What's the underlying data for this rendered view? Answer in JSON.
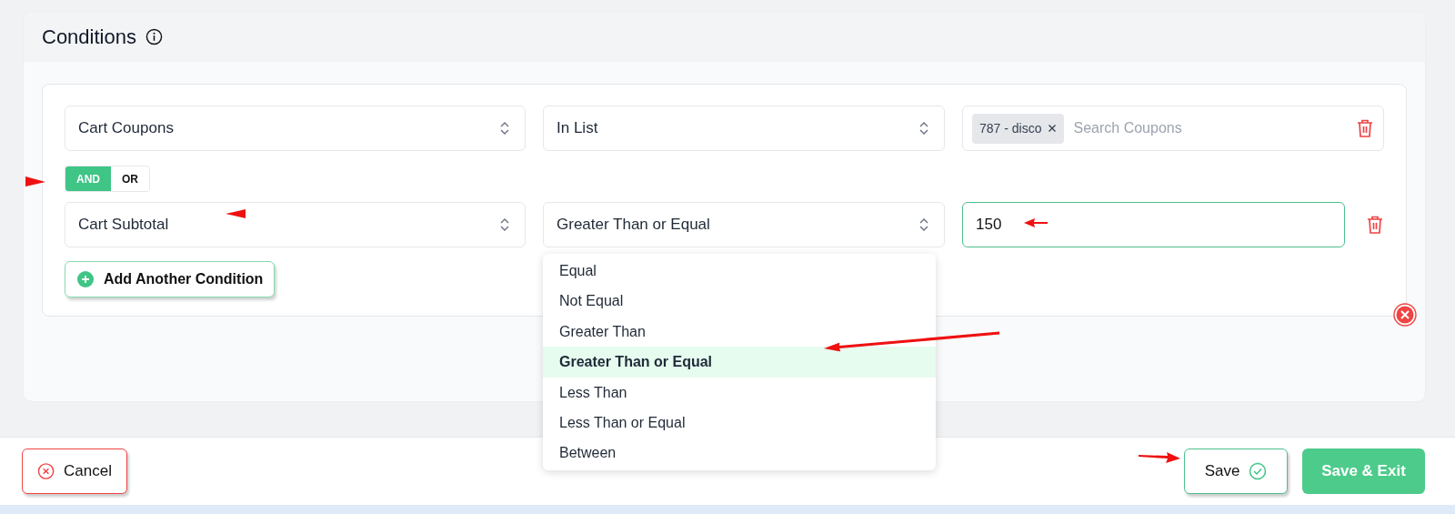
{
  "section": {
    "title": "Conditions"
  },
  "conditions": [
    {
      "field": "Cart Coupons",
      "operator": "In List",
      "kind": "tags",
      "tags": [
        {
          "label": "787 - disco"
        }
      ],
      "placeholder": "Search Coupons",
      "focused": false,
      "menu_open": false
    },
    {
      "field": "Cart Subtotal",
      "operator": "Greater Than or Equal",
      "kind": "text",
      "value": "150",
      "focused": true,
      "menu_open": true
    }
  ],
  "logic": [
    {
      "label": "AND",
      "selected": true
    },
    {
      "label": "OR",
      "selected": false
    }
  ],
  "add_button": "Add Another Condition",
  "operator_menu": [
    {
      "label": "Equal",
      "selected": false
    },
    {
      "label": "Not Equal",
      "selected": false
    },
    {
      "label": "Greater Than",
      "selected": false
    },
    {
      "label": "Greater Than or Equal",
      "selected": true
    },
    {
      "label": "Less Than",
      "selected": false
    },
    {
      "label": "Less Than or Equal",
      "selected": false
    },
    {
      "label": "Between",
      "selected": false
    }
  ],
  "footer": {
    "cancel": "Cancel",
    "save": "Save",
    "save_exit": "Save & Exit"
  }
}
